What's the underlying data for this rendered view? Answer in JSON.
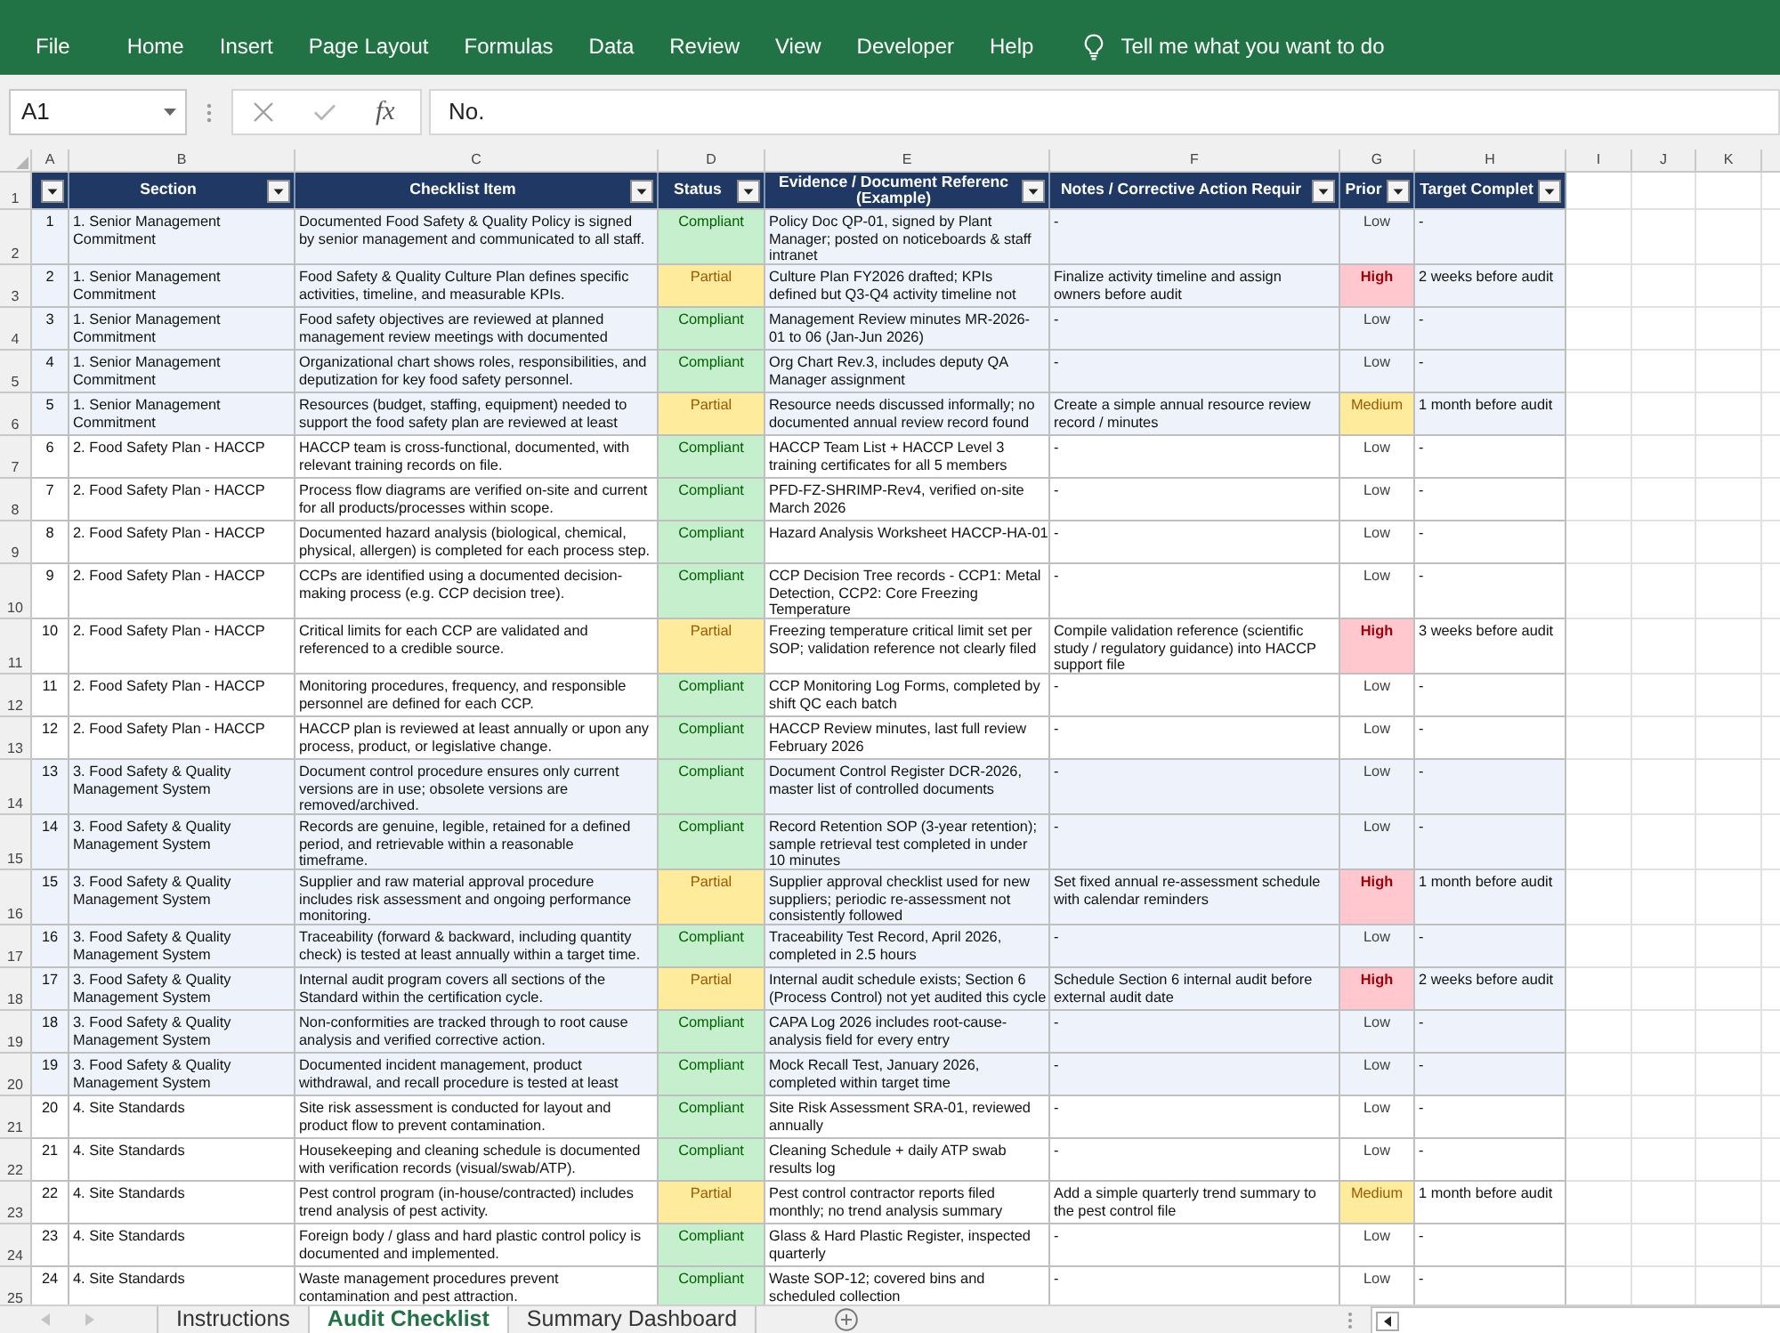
{
  "ribbon": {
    "tabs": [
      {
        "label": "File"
      },
      {
        "label": "Home"
      },
      {
        "label": "Insert"
      },
      {
        "label": "Page Layout"
      },
      {
        "label": "Formulas"
      },
      {
        "label": "Data"
      },
      {
        "label": "Review"
      },
      {
        "label": "View"
      },
      {
        "label": "Developer"
      },
      {
        "label": "Help"
      }
    ],
    "tell_me": "Tell me what you want to do"
  },
  "formula_bar": {
    "name_box": "A1",
    "function_label": "fx",
    "formula": "No."
  },
  "sheet": {
    "column_letters": [
      "A",
      "B",
      "C",
      "D",
      "E",
      "F",
      "G",
      "H",
      "I",
      "J",
      "K"
    ],
    "row_numbers": [
      "1",
      "2",
      "3",
      "4",
      "5",
      "6",
      "7",
      "8",
      "9",
      "10",
      "11",
      "12",
      "13",
      "14",
      "15",
      "16",
      "17",
      "18",
      "19",
      "20",
      "21",
      "22",
      "23",
      "24",
      "25"
    ]
  },
  "table": {
    "columns": [
      {
        "filter": true
      },
      {
        "heading": "Section",
        "filter": true
      },
      {
        "heading": "Checklist Item",
        "filter": true
      },
      {
        "heading": "Status",
        "filter": true
      },
      {
        "heading": "Evidence / Document Referenc\n(Example)",
        "filter": true
      },
      {
        "heading": "Notes / Corrective Action Requir",
        "filter": true
      },
      {
        "heading": "Prior",
        "filter": true
      },
      {
        "heading": "Target Complet",
        "filter": true
      }
    ],
    "rows": [
      {
        "no": "1",
        "section": "1. Senior Management\nCommitment",
        "item": "Documented Food Safety & Quality Policy is signed\nby senior management and communicated to all staff.",
        "status": {
          "text": "Compliant",
          "kind": "compliant"
        },
        "evidence": "Policy Doc QP-01, signed by Plant\nManager; posted on noticeboards & staff\nintranet",
        "notes": "-",
        "priority": {
          "text": "Low",
          "kind": "low"
        },
        "target": "-",
        "shaded": true
      },
      {
        "no": "2",
        "section": "1. Senior Management\nCommitment",
        "item": "Food Safety & Quality Culture Plan defines specific\nactivities, timeline, and measurable KPIs.",
        "status": {
          "text": "Partial",
          "kind": "partial"
        },
        "evidence": "Culture Plan FY2026 drafted; KPIs\ndefined but Q3-Q4 activity timeline not",
        "notes": "Finalize activity timeline and assign\nowners before audit",
        "priority": {
          "text": "High",
          "kind": "high"
        },
        "target": "2 weeks before audit",
        "shaded": true
      },
      {
        "no": "3",
        "section": "1. Senior Management\nCommitment",
        "item": "Food safety objectives are reviewed at planned\nmanagement review meetings with documented",
        "status": {
          "text": "Compliant",
          "kind": "compliant"
        },
        "evidence": "Management Review minutes MR-2026-\n01 to 06 (Jan-Jun 2026)",
        "notes": "-",
        "priority": {
          "text": "Low",
          "kind": "low"
        },
        "target": "-",
        "shaded": true
      },
      {
        "no": "4",
        "section": "1. Senior Management\nCommitment",
        "item": "Organizational chart shows roles, responsibilities, and\ndeputization for key food safety personnel.",
        "status": {
          "text": "Compliant",
          "kind": "compliant"
        },
        "evidence": "Org Chart Rev.3, includes deputy QA\nManager assignment",
        "notes": "-",
        "priority": {
          "text": "Low",
          "kind": "low"
        },
        "target": "-",
        "shaded": true
      },
      {
        "no": "5",
        "section": "1. Senior Management\nCommitment",
        "item": "Resources (budget, staffing, equipment) needed to\nsupport the food safety plan are reviewed at least",
        "status": {
          "text": "Partial",
          "kind": "partial"
        },
        "evidence": "Resource needs discussed informally; no\ndocumented annual review record found",
        "notes": "Create a simple annual resource review\nrecord / minutes",
        "priority": {
          "text": "Medium",
          "kind": "medium"
        },
        "target": "1 month before audit",
        "shaded": true
      },
      {
        "no": "6",
        "section": "2. Food Safety Plan - HACCP",
        "item": "HACCP team is cross-functional, documented, with\nrelevant training records on file.",
        "status": {
          "text": "Compliant",
          "kind": "compliant"
        },
        "evidence": "HACCP Team List + HACCP Level 3\ntraining certificates for all 5 members",
        "notes": "-",
        "priority": {
          "text": "Low",
          "kind": "low"
        },
        "target": "-",
        "shaded": false
      },
      {
        "no": "7",
        "section": "2. Food Safety Plan - HACCP",
        "item": "Process flow diagrams are verified on-site and current\nfor all products/processes within scope.",
        "status": {
          "text": "Compliant",
          "kind": "compliant"
        },
        "evidence": "PFD-FZ-SHRIMP-Rev4, verified on-site\nMarch 2026",
        "notes": "-",
        "priority": {
          "text": "Low",
          "kind": "low"
        },
        "target": "-",
        "shaded": false
      },
      {
        "no": "8",
        "section": "2. Food Safety Plan - HACCP",
        "item": "Documented hazard analysis (biological, chemical,\nphysical, allergen) is completed for each process step.",
        "status": {
          "text": "Compliant",
          "kind": "compliant"
        },
        "evidence": "Hazard Analysis Worksheet HACCP-HA-01",
        "notes": "-",
        "priority": {
          "text": "Low",
          "kind": "low"
        },
        "target": "-",
        "shaded": false
      },
      {
        "no": "9",
        "section": "2. Food Safety Plan - HACCP",
        "item": "CCPs are identified using a documented decision-\nmaking process (e.g. CCP decision tree).",
        "status": {
          "text": "Compliant",
          "kind": "compliant"
        },
        "evidence": "CCP Decision Tree records - CCP1: Metal\nDetection, CCP2: Core Freezing\nTemperature",
        "notes": "-",
        "priority": {
          "text": "Low",
          "kind": "low"
        },
        "target": "-",
        "shaded": false
      },
      {
        "no": "10",
        "section": "2. Food Safety Plan - HACCP",
        "item": "Critical limits for each CCP are validated and\nreferenced to a credible source.",
        "status": {
          "text": "Partial",
          "kind": "partial"
        },
        "evidence": "Freezing temperature critical limit set per\nSOP; validation reference not clearly filed",
        "notes": "Compile validation reference (scientific\nstudy / regulatory guidance) into HACCP\nsupport file",
        "priority": {
          "text": "High",
          "kind": "high"
        },
        "target": "3 weeks before audit",
        "shaded": false
      },
      {
        "no": "11",
        "section": "2. Food Safety Plan - HACCP",
        "item": "Monitoring procedures, frequency, and responsible\npersonnel are defined for each CCP.",
        "status": {
          "text": "Compliant",
          "kind": "compliant"
        },
        "evidence": "CCP Monitoring Log Forms, completed by\nshift QC each batch",
        "notes": "-",
        "priority": {
          "text": "Low",
          "kind": "low"
        },
        "target": "-",
        "shaded": false
      },
      {
        "no": "12",
        "section": "2. Food Safety Plan - HACCP",
        "item": "HACCP plan is reviewed at least annually or upon any\nprocess, product, or legislative change.",
        "status": {
          "text": "Compliant",
          "kind": "compliant"
        },
        "evidence": "HACCP Review minutes, last full review\nFebruary 2026",
        "notes": "-",
        "priority": {
          "text": "Low",
          "kind": "low"
        },
        "target": "-",
        "shaded": false
      },
      {
        "no": "13",
        "section": "3. Food Safety & Quality\nManagement System",
        "item": "Document control procedure ensures only current\nversions are in use; obsolete versions are\nremoved/archived.",
        "status": {
          "text": "Compliant",
          "kind": "compliant"
        },
        "evidence": "Document Control Register DCR-2026,\nmaster list of controlled documents",
        "notes": "-",
        "priority": {
          "text": "Low",
          "kind": "low"
        },
        "target": "-",
        "shaded": true
      },
      {
        "no": "14",
        "section": "3. Food Safety & Quality\nManagement System",
        "item": "Records are genuine, legible, retained for a defined\nperiod, and retrievable within a reasonable\ntimeframe.",
        "status": {
          "text": "Compliant",
          "kind": "compliant"
        },
        "evidence": "Record Retention SOP (3-year retention);\nsample retrieval test completed in under\n10 minutes",
        "notes": "-",
        "priority": {
          "text": "Low",
          "kind": "low"
        },
        "target": "-",
        "shaded": true
      },
      {
        "no": "15",
        "section": "3. Food Safety & Quality\nManagement System",
        "item": "Supplier and raw material approval procedure\nincludes risk assessment and ongoing performance\nmonitoring.",
        "status": {
          "text": "Partial",
          "kind": "partial"
        },
        "evidence": "Supplier approval checklist used for new\nsuppliers; periodic re-assessment not\nconsistently followed",
        "notes": "Set fixed annual re-assessment schedule\nwith calendar reminders",
        "priority": {
          "text": "High",
          "kind": "high"
        },
        "target": "1 month before audit",
        "shaded": true
      },
      {
        "no": "16",
        "section": "3. Food Safety & Quality\nManagement System",
        "item": "Traceability (forward & backward, including quantity\ncheck) is tested at least annually within a target time.",
        "status": {
          "text": "Compliant",
          "kind": "compliant"
        },
        "evidence": "Traceability Test Record, April 2026,\ncompleted in 2.5 hours",
        "notes": "-",
        "priority": {
          "text": "Low",
          "kind": "low"
        },
        "target": "-",
        "shaded": true
      },
      {
        "no": "17",
        "section": "3. Food Safety & Quality\nManagement System",
        "item": "Internal audit program covers all sections of the\nStandard within the certification cycle.",
        "status": {
          "text": "Partial",
          "kind": "partial"
        },
        "evidence": "Internal audit schedule exists; Section 6\n(Process Control) not yet audited this cycle",
        "notes": "Schedule Section 6 internal audit before\nexternal audit date",
        "priority": {
          "text": "High",
          "kind": "high"
        },
        "target": "2 weeks before audit",
        "shaded": true
      },
      {
        "no": "18",
        "section": "3. Food Safety & Quality\nManagement System",
        "item": "Non-conformities are tracked through to root cause\nanalysis and verified corrective action.",
        "status": {
          "text": "Compliant",
          "kind": "compliant"
        },
        "evidence": "CAPA Log 2026 includes root-cause-\nanalysis field for every entry",
        "notes": "-",
        "priority": {
          "text": "Low",
          "kind": "low"
        },
        "target": "-",
        "shaded": true
      },
      {
        "no": "19",
        "section": "3. Food Safety & Quality\nManagement System",
        "item": "Documented incident management, product\nwithdrawal, and recall procedure is tested at least",
        "status": {
          "text": "Compliant",
          "kind": "compliant"
        },
        "evidence": "Mock Recall Test, January 2026,\ncompleted within target time",
        "notes": "-",
        "priority": {
          "text": "Low",
          "kind": "low"
        },
        "target": "-",
        "shaded": true
      },
      {
        "no": "20",
        "section": "4. Site Standards",
        "item": "Site risk assessment is conducted for layout and\nproduct flow to prevent contamination.",
        "status": {
          "text": "Compliant",
          "kind": "compliant"
        },
        "evidence": "Site Risk Assessment SRA-01, reviewed\nannually",
        "notes": "-",
        "priority": {
          "text": "Low",
          "kind": "low"
        },
        "target": "-",
        "shaded": false
      },
      {
        "no": "21",
        "section": "4. Site Standards",
        "item": "Housekeeping and cleaning schedule is documented\nwith verification records (visual/swab/ATP).",
        "status": {
          "text": "Compliant",
          "kind": "compliant"
        },
        "evidence": "Cleaning Schedule + daily ATP swab\nresults log",
        "notes": "-",
        "priority": {
          "text": "Low",
          "kind": "low"
        },
        "target": "-",
        "shaded": false
      },
      {
        "no": "22",
        "section": "4. Site Standards",
        "item": "Pest control program (in-house/contracted) includes\ntrend analysis of pest activity.",
        "status": {
          "text": "Partial",
          "kind": "partial"
        },
        "evidence": "Pest control contractor reports filed\nmonthly; no trend analysis summary",
        "notes": "Add a simple quarterly trend summary to\nthe pest control file",
        "priority": {
          "text": "Medium",
          "kind": "medium"
        },
        "target": "1 month before audit",
        "shaded": false
      },
      {
        "no": "23",
        "section": "4. Site Standards",
        "item": "Foreign body / glass and hard plastic control policy is\ndocumented and implemented.",
        "status": {
          "text": "Compliant",
          "kind": "compliant"
        },
        "evidence": "Glass & Hard Plastic Register, inspected\nquarterly",
        "notes": "-",
        "priority": {
          "text": "Low",
          "kind": "low"
        },
        "target": "-",
        "shaded": false
      },
      {
        "no": "24",
        "section": "4. Site Standards",
        "item": "Waste management procedures prevent\ncontamination and pest attraction.",
        "status": {
          "text": "Compliant",
          "kind": "compliant"
        },
        "evidence": "Waste SOP-12; covered bins and\nscheduled collection",
        "notes": "-",
        "priority": {
          "text": "Low",
          "kind": "low"
        },
        "target": "-",
        "shaded": false
      }
    ]
  },
  "sheet_tabs": [
    {
      "label": "Instructions",
      "selected": false
    },
    {
      "label": "Audit Checklist",
      "selected": true
    },
    {
      "label": "Summary Dashboard",
      "selected": false
    }
  ]
}
